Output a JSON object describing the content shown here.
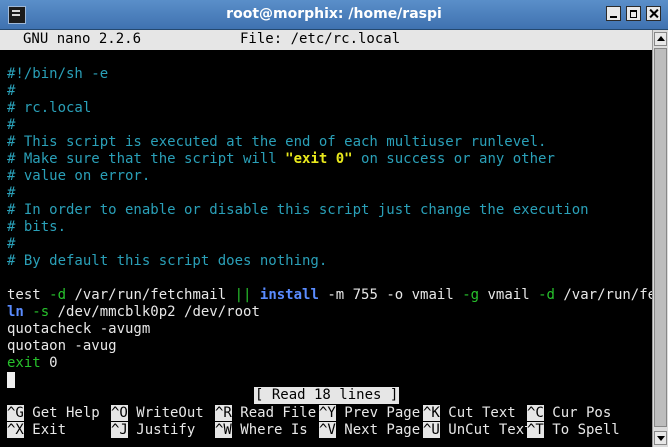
{
  "window": {
    "title": "root@morphix: /home/raspi"
  },
  "nano": {
    "version": "GNU nano 2.2.6",
    "file": "File: /etc/rc.local"
  },
  "content": {
    "l01": "#!/bin/sh -e",
    "l02": "#",
    "l03": "# rc.local",
    "l04": "#",
    "l05": "# This script is executed at the end of each multiuser runlevel.",
    "l06a": "# Make sure that the script will ",
    "l06b": "\"exit 0\"",
    "l06c": " on success or any other",
    "l07": "# value on error.",
    "l08": "#",
    "l09": "# In order to enable or disable this script just change the execution",
    "l10": "# bits.",
    "l11": "#",
    "l12": "# By default this script does nothing.",
    "l14a": "test ",
    "l14b": "-d",
    "l14c": " /var/run/fetchmail ",
    "l14d": "||",
    "l14e": " ",
    "l14f": "install",
    "l14g": " -m 755 -o vmail ",
    "l14h": "-g",
    "l14i": " vmail ",
    "l14j": "-d",
    "l14k": " /var/run/fetc",
    "l14l": "$",
    "l15a": "ln ",
    "l15b": "-s",
    "l15c": " /dev/mmcblk0p2 /dev/root",
    "l16": "quotacheck -avugm",
    "l17": "quotaon -avug",
    "l18a": "exit",
    "l18b": " 0"
  },
  "status": "[ Read 18 lines ]",
  "shortcuts": [
    {
      "key": "^G",
      "label": " Get Help"
    },
    {
      "key": "^O",
      "label": " WriteOut"
    },
    {
      "key": "^R",
      "label": " Read File"
    },
    {
      "key": "^Y",
      "label": " Prev Page"
    },
    {
      "key": "^K",
      "label": " Cut Text"
    },
    {
      "key": "^C",
      "label": " Cur Pos"
    },
    {
      "key": "^X",
      "label": " Exit"
    },
    {
      "key": "^J",
      "label": " Justify"
    },
    {
      "key": "^W",
      "label": " Where Is"
    },
    {
      "key": "^V",
      "label": " Next Page"
    },
    {
      "key": "^U",
      "label": " UnCut Text"
    },
    {
      "key": "^T",
      "label": " To Spell"
    }
  ]
}
